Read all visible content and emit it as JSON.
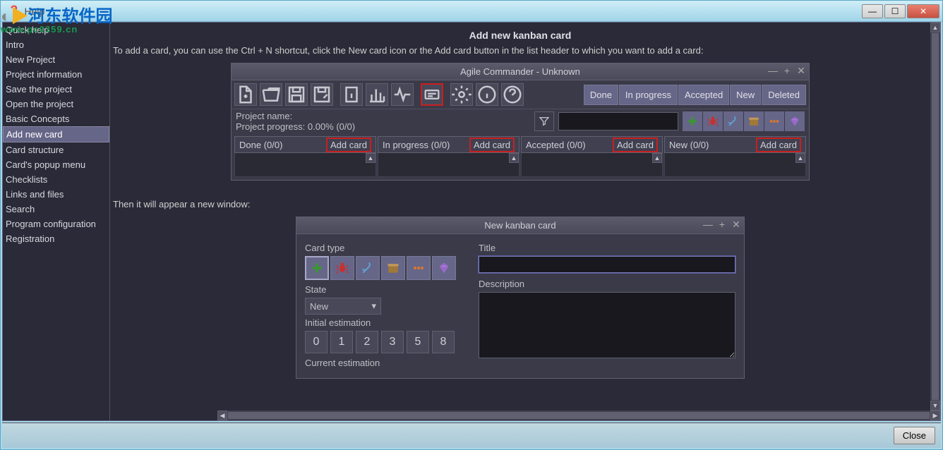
{
  "outer": {
    "help_menu": "Help",
    "min": "—",
    "max": "☐",
    "close": "✕",
    "close_btn": "Close"
  },
  "watermark": {
    "brand": "河东软件园",
    "url": "www.pc0359.cn"
  },
  "sidebar": {
    "items": [
      "Quick help",
      "Intro",
      "New Project",
      "Project information",
      "Save the project",
      "Open the project",
      "Basic Concepts",
      "Add new card",
      "Card structure",
      "Card's popup menu",
      "Checklists",
      "Links and files",
      "Search",
      "Program configuration",
      "Registration"
    ],
    "selected_index": 7
  },
  "page": {
    "title": "Add new kanban card",
    "intro": "To add a card, you can use the Ctrl + N shortcut, click the New card icon or the Add card button in the list header to which you want to add a card:",
    "then": "Then it will appear a new window:"
  },
  "iw1": {
    "title": "Agile Commander - Unknown",
    "toolbar_icons": [
      "new-file-icon",
      "open-icon",
      "save-icon",
      "save-as-icon",
      "info-icon",
      "chart-icon",
      "activity-icon",
      "card-new-icon",
      "gear-icon",
      "help-icon",
      "question-icon"
    ],
    "status_buttons": [
      "Done",
      "In progress",
      "Accepted",
      "New",
      "Deleted"
    ],
    "project_name_label": "Project name:",
    "project_progress": "Project progress: 0.00% (0/0)",
    "filter_placeholder": "",
    "right_icons": [
      "plus-icon",
      "bug-icon",
      "tool-icon",
      "box-icon",
      "dots-icon",
      "diamond-icon"
    ],
    "columns": [
      {
        "label": "Done (0/0)",
        "btn": "Add card"
      },
      {
        "label": "In progress (0/0)",
        "btn": "Add card"
      },
      {
        "label": "Accepted (0/0)",
        "btn": "Add card"
      },
      {
        "label": "New (0/0)",
        "btn": "Add card"
      }
    ]
  },
  "iw2": {
    "title": "New kanban card",
    "card_type_label": "Card type",
    "type_icons": [
      "plus-icon",
      "bug-icon",
      "tool-icon",
      "box-icon",
      "dots-icon",
      "diamond-icon"
    ],
    "state_label": "State",
    "state_value": "New",
    "init_est_label": "Initial estimation",
    "curr_est_label": "Current estimation",
    "est_values": [
      "0",
      "1",
      "2",
      "3",
      "5",
      "8"
    ],
    "title_label": "Title",
    "title_value": "",
    "desc_label": "Description",
    "desc_value": ""
  }
}
